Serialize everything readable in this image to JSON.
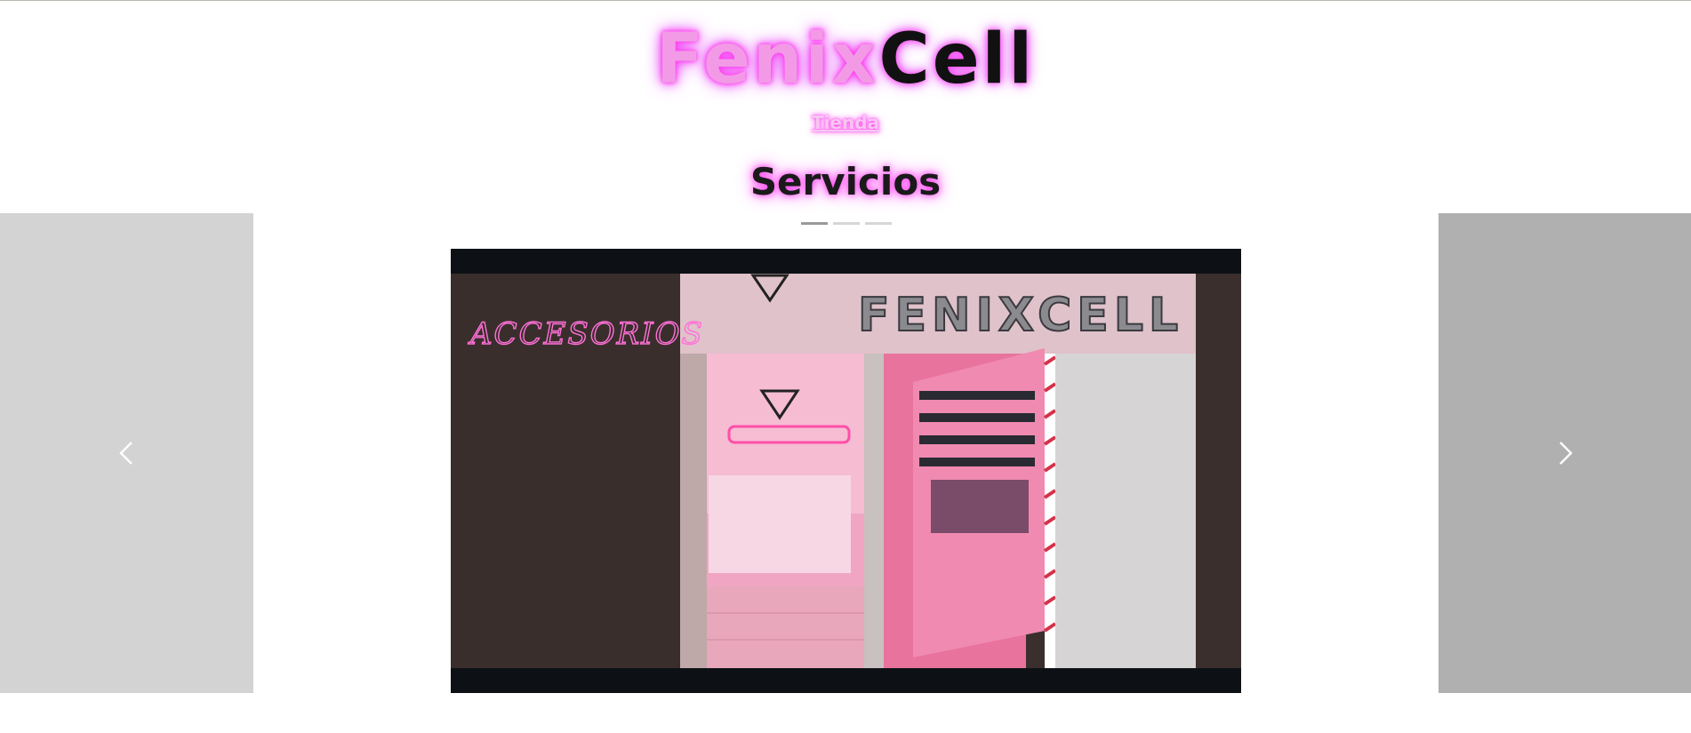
{
  "header": {
    "brand_part1": "Fenix",
    "brand_part2": "Cell",
    "nav_link": "Tienda"
  },
  "section": {
    "title": "Servicios"
  },
  "carousel": {
    "indicator_count": 3,
    "active_index": 0,
    "slide": {
      "sign_text": "FENIXCELL",
      "neon_text": "ACCESORIOS"
    },
    "prev_icon": "chevron-left-icon",
    "next_icon": "chevron-right-icon"
  },
  "colors": {
    "neon_pink": "#ff3cf0",
    "brand_pink": "#f29ae6",
    "dark": "#111111",
    "panel_left": "#d3d3d3",
    "panel_right": "#b0b0b0",
    "slide_bg": "#0d1116"
  }
}
